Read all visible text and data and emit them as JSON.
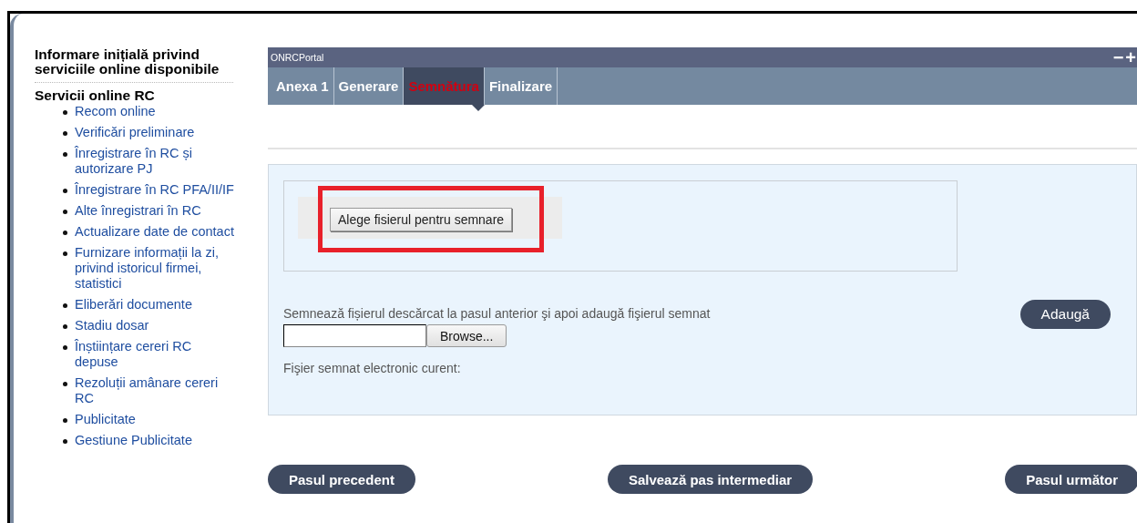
{
  "sidebar": {
    "intro_title": "Informare inițială privind serviciile online disponibile",
    "section_title": "Servicii online RC",
    "items": [
      {
        "label": "Recom online"
      },
      {
        "label": "Verificări preliminare"
      },
      {
        "label": "Înregistrare în RC și autorizare PJ"
      },
      {
        "label": "Înregistrare în RC PFA/II/IF"
      },
      {
        "label": "Alte înregistrari în RC"
      },
      {
        "label": "Actualizare date de contact"
      },
      {
        "label": "Furnizare informații la zi, privind istoricul firmei, statistici"
      },
      {
        "label": "Eliberări documente"
      },
      {
        "label": "Stadiu dosar"
      },
      {
        "label": "Înștiințare cereri RC depuse"
      },
      {
        "label": "Rezoluții amânare cereri RC"
      },
      {
        "label": "Publicitate"
      },
      {
        "label": "Gestiune Publicitate"
      }
    ]
  },
  "portlet": {
    "title": "ONRCPortal",
    "minimize": "−",
    "maximize": "+"
  },
  "tabs": [
    {
      "label": "Anexa 1",
      "selected": false
    },
    {
      "label": "Generare",
      "selected": false
    },
    {
      "label": "Semnătura",
      "selected": true
    },
    {
      "label": "Finalizare",
      "selected": false
    }
  ],
  "sign_box": {
    "choose_button": "Alege fisierul pentru semnare",
    "highlighted": true
  },
  "upload": {
    "instruction": "Semnează fișierul descărcat la pasul anterior şi apoi adaugă fişierul semnat",
    "browse_button": "Browse...",
    "add_button": "Adaugă",
    "current_file_label": "Fişier semnat electronic curent:"
  },
  "footer": {
    "previous": "Pasul precedent",
    "save": "Salvează pas intermediar",
    "next": "Pasul următor"
  }
}
